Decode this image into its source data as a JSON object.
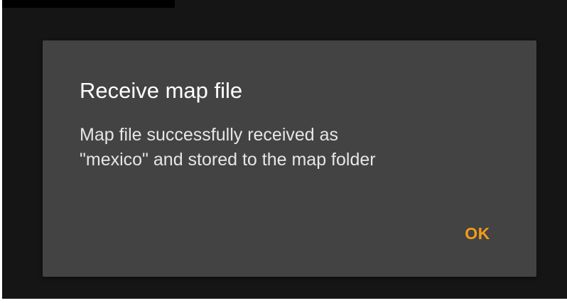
{
  "dialog": {
    "title": "Receive map file",
    "message_lines": [
      "Map file successfully received as",
      "\"mexico\" and stored to the map folder"
    ],
    "ok_label": "OK"
  },
  "colors": {
    "accent": "#f39c1a",
    "dialog_background": "#434343",
    "screen_background": "#151515"
  }
}
